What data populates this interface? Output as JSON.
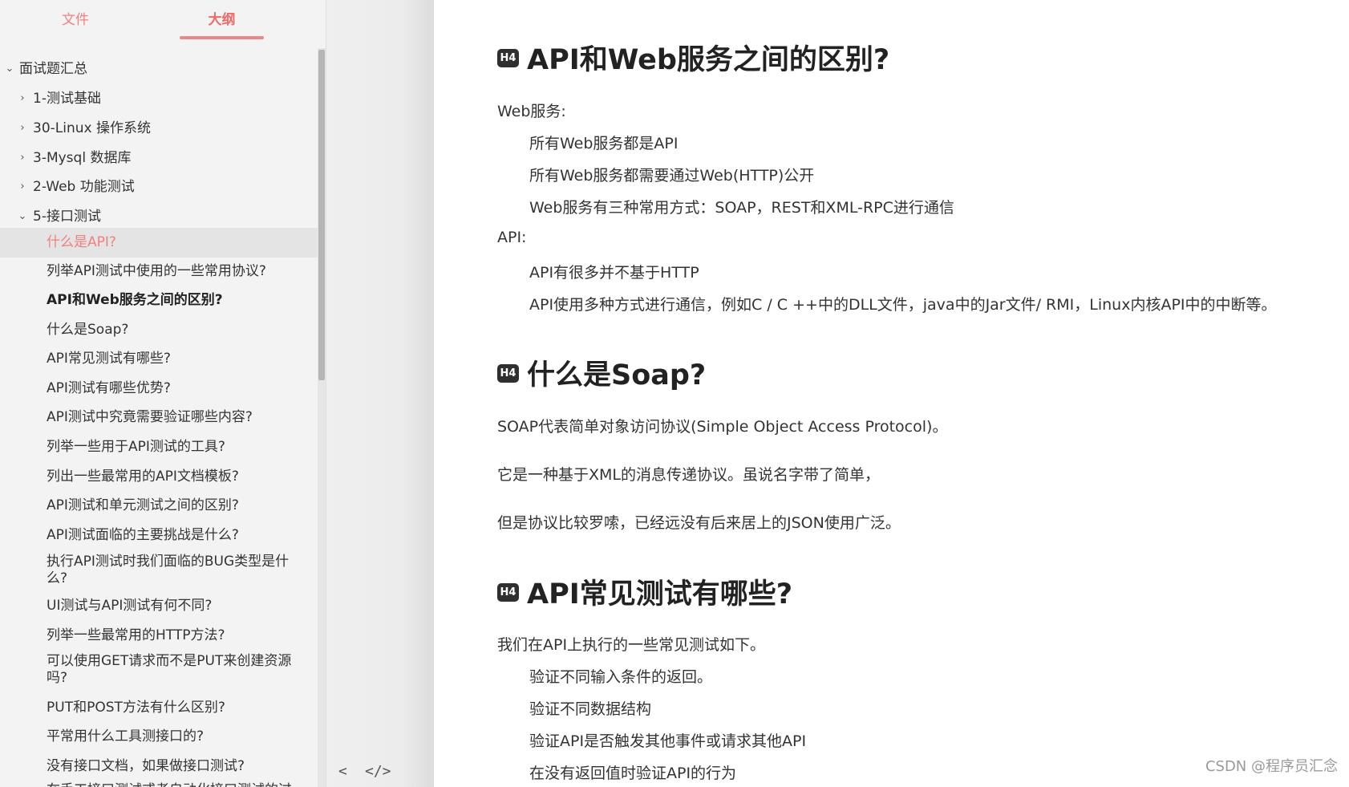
{
  "sidebar": {
    "tabs": {
      "files": "文件",
      "outline": "大纲"
    },
    "root": "面试题汇总",
    "items": [
      "1-测试基础",
      "30-Linux 操作系统",
      "3-Mysql 数据库",
      "2-Web 功能测试",
      "5-接口测试"
    ],
    "subitems": [
      "什么是API?",
      "列举API测试中使用的一些常用协议?",
      "API和Web服务之间的区别?",
      "什么是Soap?",
      "API常见测试有哪些?",
      "API测试有哪些优势?",
      "API测试中究竟需要验证哪些内容?",
      "列举一些用于API测试的工具?",
      "列出一些最常用的API文档模板?",
      "API测试和单元测试之间的区别?",
      "API测试面临的主要挑战是什么?",
      "执行API测试时我们面临的BUG类型是什么?",
      "UI测试与API测试有何不同?",
      "列举一些最常用的HTTP方法?",
      "可以使用GET请求而不是PUT来创建资源吗?",
      "PUT和POST方法有什么区别?",
      "平常用什么工具测接口的?",
      "没有接口文档，如果做接口测试?",
      "在手工接口测试或者自动化接口测试的过"
    ]
  },
  "gutter": {
    "back": "<",
    "source": "</>"
  },
  "content": {
    "badge": "H4",
    "s1": {
      "title": "API和Web服务之间的区别?",
      "web_label": "Web服务:",
      "web_points": [
        "所有Web服务都是API",
        "所有Web服务都需要通过Web(HTTP)公开",
        "Web服务有三种常用方式：SOAP，REST和XML-RPC进行通信"
      ],
      "api_label": "API:",
      "api_points": [
        "API有很多并不基于HTTP",
        "API使用多种方式进行通信，例如C / C ++中的DLL文件，java中的Jar文件/ RMI，Linux内核API中的中断等。"
      ]
    },
    "s2": {
      "title": "什么是Soap?",
      "paras": [
        "SOAP代表简单对象访问协议(Simple Object Access Protocol)。",
        "它是一种基于XML的消息传递协议。虽说名字带了简单，",
        "但是协议比较罗嗦，已经远没有后来居上的JSON使用广泛。"
      ]
    },
    "s3": {
      "title": "API常见测试有哪些?",
      "intro": "我们在API上执行的一些常见测试如下。",
      "points": [
        "验证不同输入条件的返回。",
        "验证不同数据结构",
        "验证API是否触发其他事件或请求其他API",
        "在没有返回值时验证API的行为"
      ]
    }
  },
  "watermark": "CSDN @程序员汇念",
  "colors": {
    "accent": "#f08080",
    "active_bg": "#e4e4e4",
    "badge_bg": "#2f2f2f"
  }
}
